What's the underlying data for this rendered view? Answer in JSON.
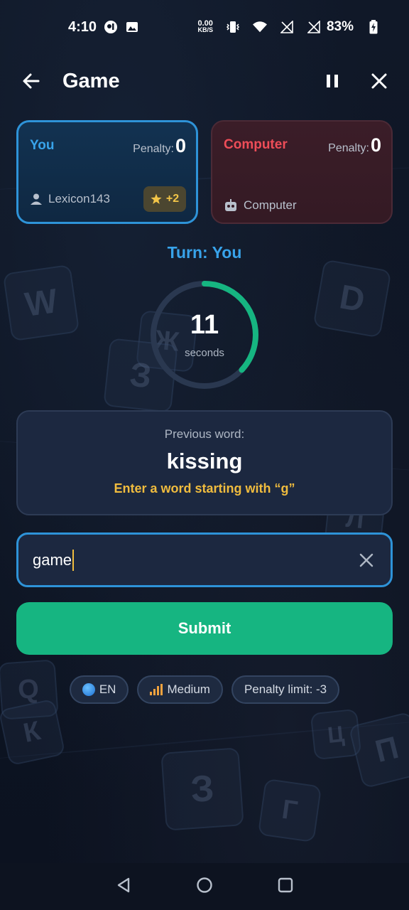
{
  "status_bar": {
    "time": "4:10",
    "net_speed_value": "0.00",
    "net_speed_unit": "KB/S",
    "battery": "83%"
  },
  "header": {
    "title": "Game"
  },
  "players": {
    "you": {
      "name": "You",
      "penalty_label": "Penalty:",
      "penalty_value": "0",
      "username": "Lexicon143",
      "bonus": "+2"
    },
    "computer": {
      "name": "Computer",
      "penalty_label": "Penalty:",
      "penalty_value": "0",
      "username": "Computer"
    }
  },
  "turn": {
    "label": "Turn: You"
  },
  "timer": {
    "value": "11",
    "unit": "seconds",
    "remaining_fraction": 0.37
  },
  "previous": {
    "label": "Previous word:",
    "word": "kissing",
    "hint": "Enter a word starting with “g”"
  },
  "input": {
    "value": "game"
  },
  "submit": {
    "label": "Submit"
  },
  "chips": {
    "language": "EN",
    "difficulty": "Medium",
    "penalty_limit": "Penalty limit: -3"
  },
  "background_letters": [
    "W",
    "D",
    "Ж",
    "З",
    "Q",
    "К",
    "Ц",
    "П",
    "З",
    "Г",
    "Л"
  ],
  "colors": {
    "accent_blue": "#2e93d8",
    "computer_red": "#ee4d58",
    "hint_gold": "#f0bc3e",
    "submit_green": "#16b581",
    "background": "#0e1626"
  }
}
